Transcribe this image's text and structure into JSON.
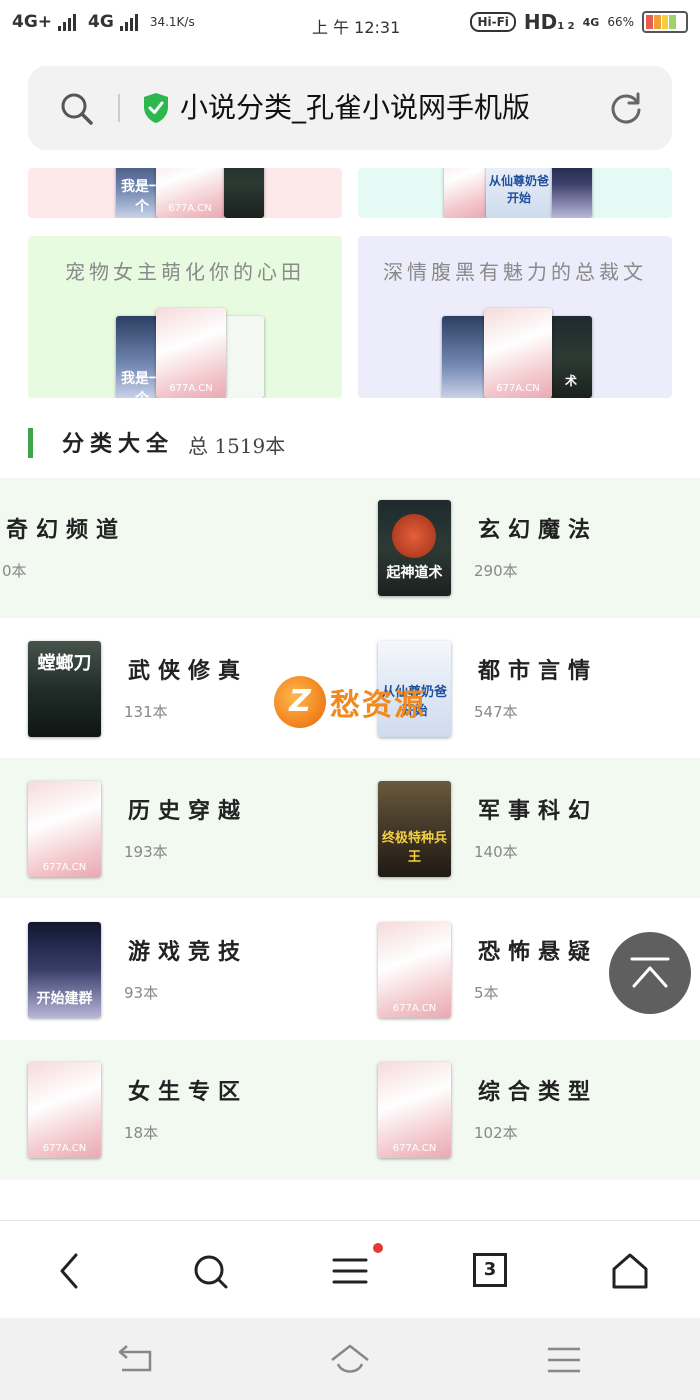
{
  "status_bar": {
    "network1": "4G+",
    "network2": "4G",
    "speed": "34.1K/s",
    "time": "上 午 12:31",
    "hifi": "Hi-Fi",
    "hd": "HD",
    "hd_sub": "1 2",
    "network3": "4G",
    "battery_percent": "66%",
    "battery_level": 0.66
  },
  "url_bar": {
    "title": "小说分类_孔雀小说网手机版",
    "secure": true
  },
  "topic_cards": [
    {
      "title": "",
      "bg": "#fde8ea"
    },
    {
      "title": "",
      "bg": "#e6faf5"
    },
    {
      "title": "宠物女主萌化你的心田",
      "bg": "#e6fbe0"
    },
    {
      "title": "深情腹黑有魅力的总裁文",
      "bg": "#ececfb"
    }
  ],
  "cover_texts": {
    "rose_label": "677A.CN",
    "dark_title": "起神道术",
    "white_title": "从仙尊奶爸开始",
    "night_title": "开始建群",
    "war_title": "终极特种兵王",
    "mantis_title": "螳螂刀",
    "partial_title": "我是一个",
    "partial_title2": "我是一个"
  },
  "section": {
    "title": "分类大全",
    "count": "总 1519本"
  },
  "categories": [
    {
      "name": "奇幻频道",
      "count": "0本",
      "cover": "none"
    },
    {
      "name": "玄幻魔法",
      "count": "290本",
      "cover": "dark"
    },
    {
      "name": "武侠修真",
      "count": "131本",
      "cover": "mantis"
    },
    {
      "name": "都市言情",
      "count": "547本",
      "cover": "white"
    },
    {
      "name": "历史穿越",
      "count": "193本",
      "cover": "rose"
    },
    {
      "name": "军事科幻",
      "count": "140本",
      "cover": "war"
    },
    {
      "name": "游戏竞技",
      "count": "93本",
      "cover": "night"
    },
    {
      "name": "恐怖悬疑",
      "count": "5本",
      "cover": "rose"
    },
    {
      "name": "女生专区",
      "count": "18本",
      "cover": "rose"
    },
    {
      "name": "综合类型",
      "count": "102本",
      "cover": "rose"
    }
  ],
  "watermark": {
    "logo": "Z",
    "text": "愁资源"
  },
  "browser_bar": {
    "tab_count": "3",
    "menu_has_notification": true
  },
  "colors": {
    "accent_green": "#3fa34d",
    "row_green": "#f2f9f1",
    "watermark_orange": "#f0891e"
  }
}
